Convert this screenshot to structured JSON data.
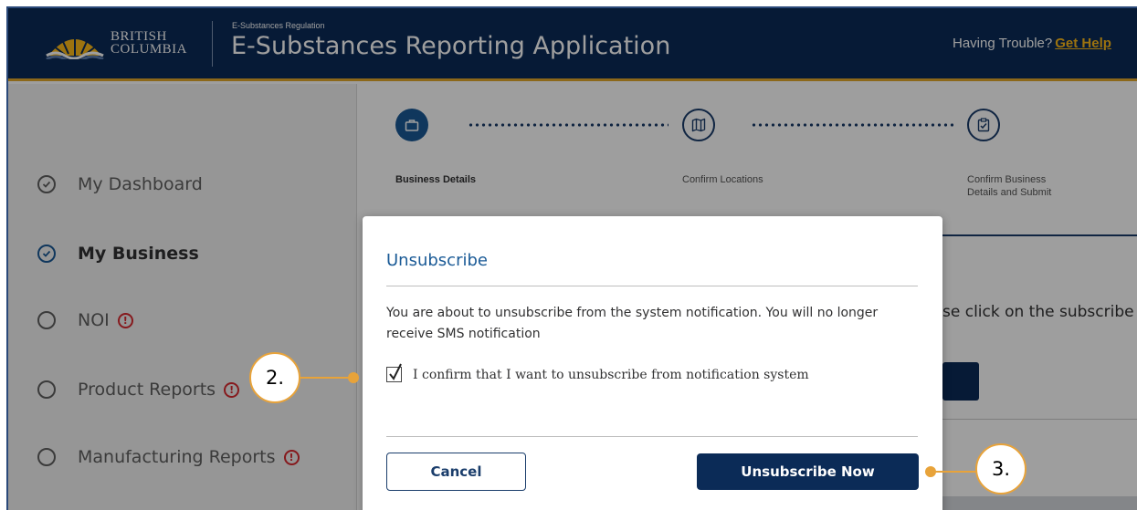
{
  "header": {
    "logo_line1": "BRITISH",
    "logo_line2": "COLUMBIA",
    "kicker": "E-Substances Regulation",
    "title": "E-Substances Reporting Application",
    "help_prefix": "Having Trouble?",
    "help_link": "Get Help"
  },
  "sidebar": {
    "items": [
      {
        "label": "My Dashboard",
        "icon": "check-circle-icon",
        "state": "done"
      },
      {
        "label": "My Business",
        "icon": "check-circle-icon",
        "state": "active"
      },
      {
        "label": "NOI",
        "icon": "radio-empty-icon",
        "alert": "!"
      },
      {
        "label": "Product Reports",
        "icon": "radio-empty-icon",
        "alert": "!"
      },
      {
        "label": "Manufacturing Reports",
        "icon": "radio-empty-icon",
        "alert": "!"
      }
    ]
  },
  "stepper": {
    "steps": [
      {
        "label": "Business Details",
        "icon": "briefcase-icon",
        "state": "current"
      },
      {
        "label": "Confirm Locations",
        "icon": "map-icon",
        "state": "future"
      },
      {
        "label_line1": "Confirm Business",
        "label_line2": "Details and Submit",
        "icon": "clipboard-check-icon",
        "state": "future"
      }
    ]
  },
  "content": {
    "partial_text": "se click on the subscribe"
  },
  "modal": {
    "title": "Unsubscribe",
    "message": "You are about to unsubscribe from the system notification. You will no longer receive SMS notification",
    "confirm_label": "I confirm that I want to unsubscribe from notification system",
    "confirm_checked": true,
    "cancel_label": "Cancel",
    "unsubscribe_label": "Unsubscribe Now"
  },
  "callouts": [
    {
      "label": "2."
    },
    {
      "label": "3."
    }
  ],
  "colors": {
    "header_bg": "#0b2b57",
    "header_accent": "#e3a82b",
    "link": "#fcba19",
    "primary": "#1a5a96",
    "alert": "#d8292f",
    "callout": "#e8a33a"
  }
}
